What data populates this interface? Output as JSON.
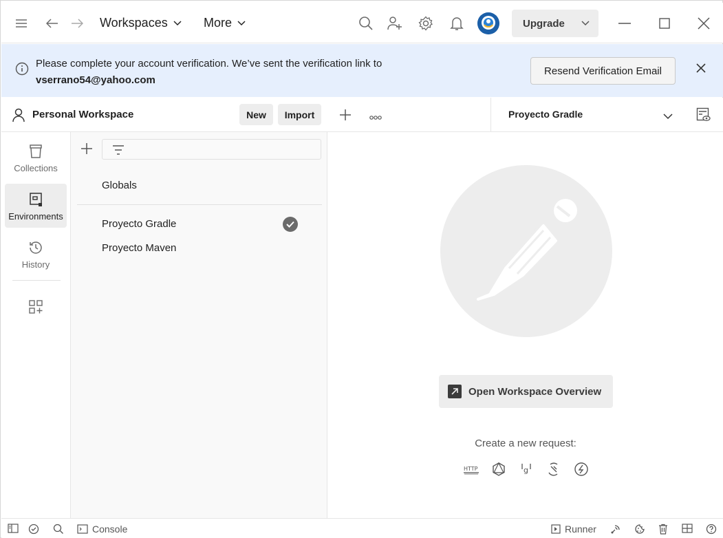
{
  "titlebar": {
    "workspaces_label": "Workspaces",
    "more_label": "More",
    "upgrade_label": "Upgrade"
  },
  "banner": {
    "message": "Please complete your account verification. We’ve sent the verification link to",
    "email": "vserrano54@yahoo.com",
    "resend_label": "Resend Verification Email"
  },
  "workspace": {
    "name": "Personal Workspace",
    "new_label": "New",
    "import_label": "Import"
  },
  "rail": {
    "items": [
      {
        "label": "Collections",
        "icon": "collections-icon",
        "active": false
      },
      {
        "label": "Environments",
        "icon": "environments-icon",
        "active": true
      },
      {
        "label": "History",
        "icon": "history-icon",
        "active": false
      }
    ]
  },
  "environments": {
    "globals": "Globals",
    "items": [
      {
        "name": "Proyecto Gradle",
        "active": true
      },
      {
        "name": "Proyecto Maven",
        "active": false
      }
    ]
  },
  "top_right": {
    "selected_environment": "Proyecto Gradle"
  },
  "main": {
    "overview_label": "Open Workspace Overview",
    "create_label": "Create a new request:",
    "request_types": [
      "http-icon",
      "graphql-icon",
      "grpc-icon",
      "websocket-icon",
      "socketio-icon"
    ]
  },
  "statusbar": {
    "console_label": "Console",
    "runner_label": "Runner"
  },
  "colors": {
    "banner_bg": "#e6effd",
    "active_bg": "#ededed",
    "avatar": "#1b5fa8"
  }
}
